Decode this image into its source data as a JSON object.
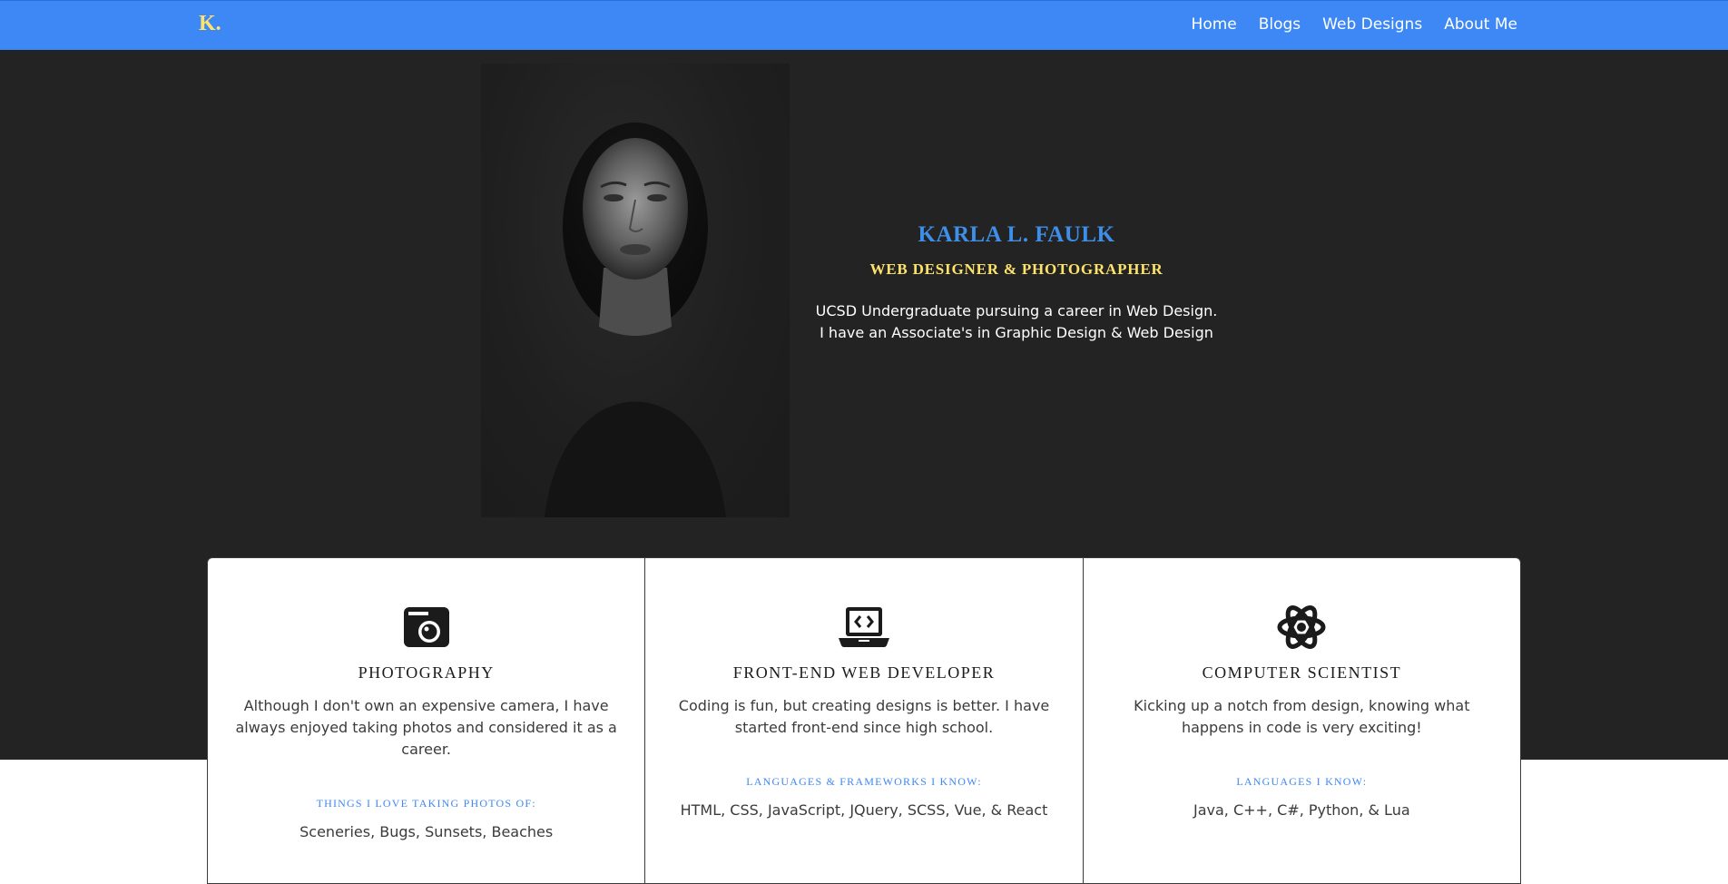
{
  "nav": {
    "brand": "K.",
    "links": [
      "Home",
      "Blogs",
      "Web Designs",
      "About Me"
    ]
  },
  "hero": {
    "name": "KARLA L. FAULK",
    "role": "WEB DESIGNER & PHOTOGRAPHER",
    "desc_line1": "UCSD Undergraduate pursuing a career in Web Design.",
    "desc_line2": "I have an Associate's in Graphic Design & Web Design"
  },
  "cards": [
    {
      "icon": "camera-icon",
      "title": "PHOTOGRAPHY",
      "text": "Although I don't own an expensive camera, I have always enjoyed taking photos and considered it as a career.",
      "subheading": "THINGS I LOVE TAKING PHOTOS OF:",
      "list": "Sceneries, Bugs, Sunsets, Beaches"
    },
    {
      "icon": "laptop-code-icon",
      "title": "FRONT-END WEB DEVELOPER",
      "text": "Coding is fun, but creating designs is better. I have started front-end since high school.",
      "subheading": "LANGUAGES & FRAMEWORKS I KNOW:",
      "list": "HTML, CSS, JavaScript, JQuery, SCSS, Vue, & React"
    },
    {
      "icon": "atom-icon",
      "title": "COMPUTER SCIENTIST",
      "text": "Kicking up a notch from design, knowing what happens in code is very exciting!",
      "subheading": "LANGUAGES I KNOW:",
      "list": "Java, C++, C#, Python, & Lua"
    }
  ],
  "colors": {
    "nav_bg": "#3d88f5",
    "brand": "#fde36a",
    "hero_bg": "#232323",
    "name": "#3d8fe8",
    "role": "#fde36a"
  }
}
